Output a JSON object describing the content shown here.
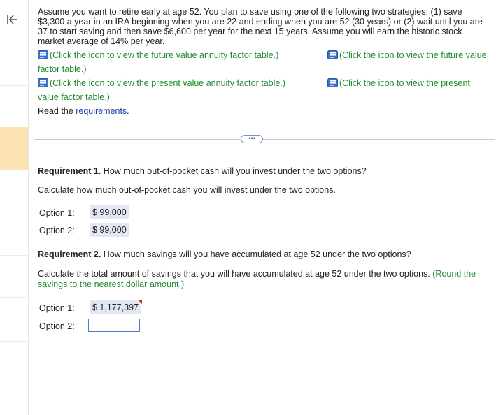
{
  "problem": {
    "intro": "Assume you want to retire early at age 52. You plan to save using one of the following two strategies: (1) save $3,300 a year in an IRA beginning when you are 22 and ending when you are 52 (30 years) or (2) wait until you are 37 to start saving and then save $6,600 per year for the next 15 years. Assume you will earn the historic stock market average of 14% per year.",
    "fv_annuity_link": "(Click the icon to view the future value annuity factor table.)",
    "fv_link_start": "(Click the icon to view the future value",
    "fv_link_cont": "factor table.)",
    "pv_annuity_link": "(Click the icon to view the present value annuity factor table.)",
    "pv_link_start": "(Click the icon to view the present",
    "pv_link_cont": "value factor table.)",
    "read_prefix": "Read the ",
    "requirements_link": "requirements",
    "read_suffix": "."
  },
  "divider": {
    "more_label": "•••"
  },
  "req1": {
    "title": "Requirement 1.",
    "question": " How much out-of-pocket cash will you invest under the two options?",
    "instruction": "Calculate how much out-of-pocket cash you will invest under the two options.",
    "option1_label": "Option 1:",
    "option1_value": "$  99,000",
    "option2_label": "Option 2:",
    "option2_value": "$  99,000"
  },
  "req2": {
    "title": "Requirement 2.",
    "question": " How much savings will you have accumulated at age 52 under the two options?",
    "instruction": "Calculate the total amount of savings that you will have accumulated at age 52 under the two options.",
    "round_note": "(Round the savings to the nearest dollar amount.)",
    "option1_label": "Option 1:",
    "option1_value": "$ 1,177,397",
    "option2_label": "Option 2:",
    "option2_value": ""
  },
  "colors": {
    "accent_green": "#1f8a2e",
    "link_blue": "#1a3fb0",
    "input_border": "#4d79c9",
    "sidebar_highlight": "#fbe3b4"
  }
}
